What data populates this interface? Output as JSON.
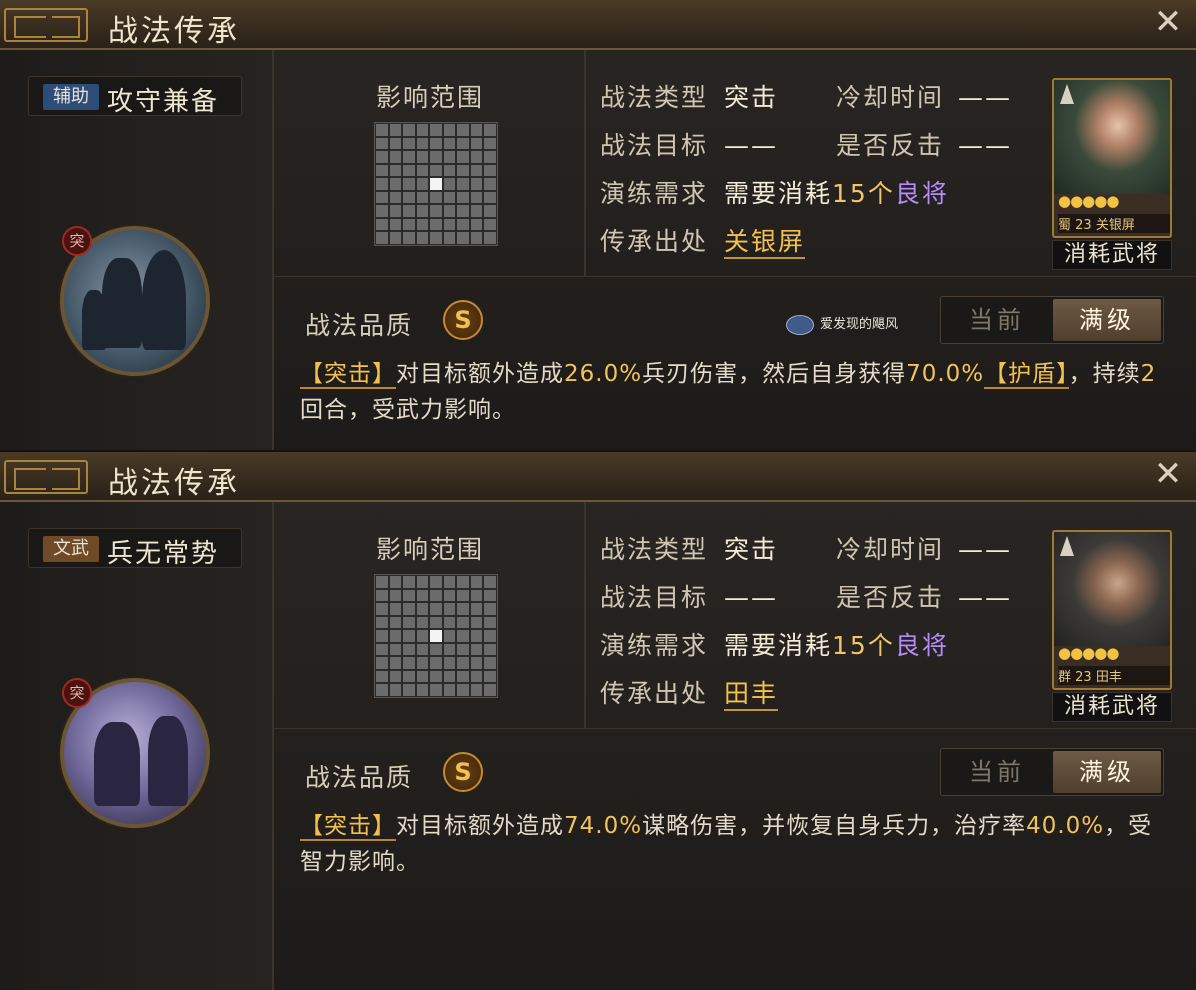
{
  "panels": [
    {
      "header_title": "战法传承",
      "skill": {
        "tag": "辅助",
        "tag_color": "#2e4c78",
        "name": "攻守兼备",
        "type_badge": "突"
      },
      "range_label": "影响范围",
      "info": {
        "type_label": "战法类型",
        "type_value": "突击",
        "cooldown_label": "冷却时间",
        "cooldown_value": "——",
        "target_label": "战法目标",
        "target_value": "——",
        "counter_label": "是否反击",
        "counter_value": "——",
        "req_label": "演练需求",
        "req_prefix": "需要消耗",
        "req_count": "15个",
        "req_item": "良将",
        "origin_label": "传承出处",
        "origin_value": "关银屏"
      },
      "card": {
        "stars": "●●●●●",
        "faction": "蜀",
        "level": "23",
        "name": "关银屏",
        "label": "消耗武将"
      },
      "quality_label": "战法品质",
      "quality_value": "S",
      "watermark": "爱发现的飓风",
      "toggle": {
        "current": "当前",
        "max": "满级"
      },
      "desc": {
        "p1": "【突击】",
        "p2": "对目标额外造成",
        "p3": "26.0%",
        "p4": "兵刃伤害，然后自身获得",
        "p5": "70.0%",
        "p6": "【护盾】",
        "p7": "，持续",
        "p8": "2",
        "p9": "回合，受武力影响。"
      }
    },
    {
      "header_title": "战法传承",
      "skill": {
        "tag": "文武",
        "tag_color": "#6e4a26",
        "name": "兵无常势",
        "type_badge": "突"
      },
      "range_label": "影响范围",
      "info": {
        "type_label": "战法类型",
        "type_value": "突击",
        "cooldown_label": "冷却时间",
        "cooldown_value": "——",
        "target_label": "战法目标",
        "target_value": "——",
        "counter_label": "是否反击",
        "counter_value": "——",
        "req_label": "演练需求",
        "req_prefix": "需要消耗",
        "req_count": "15个",
        "req_item": "良将",
        "origin_label": "传承出处",
        "origin_value": "田丰"
      },
      "card": {
        "stars": "●●●●●",
        "faction": "群",
        "level": "23",
        "name": "田丰",
        "label": "消耗武将"
      },
      "quality_label": "战法品质",
      "quality_value": "S",
      "toggle": {
        "current": "当前",
        "max": "满级"
      },
      "desc": {
        "p1": "【突击】",
        "p2": "对目标额外造成",
        "p3": "74.0%",
        "p4": "谋略伤害，并恢复自身兵力，治疗率",
        "p5": "40.0%",
        "p6": "，受智力影响。"
      }
    }
  ]
}
